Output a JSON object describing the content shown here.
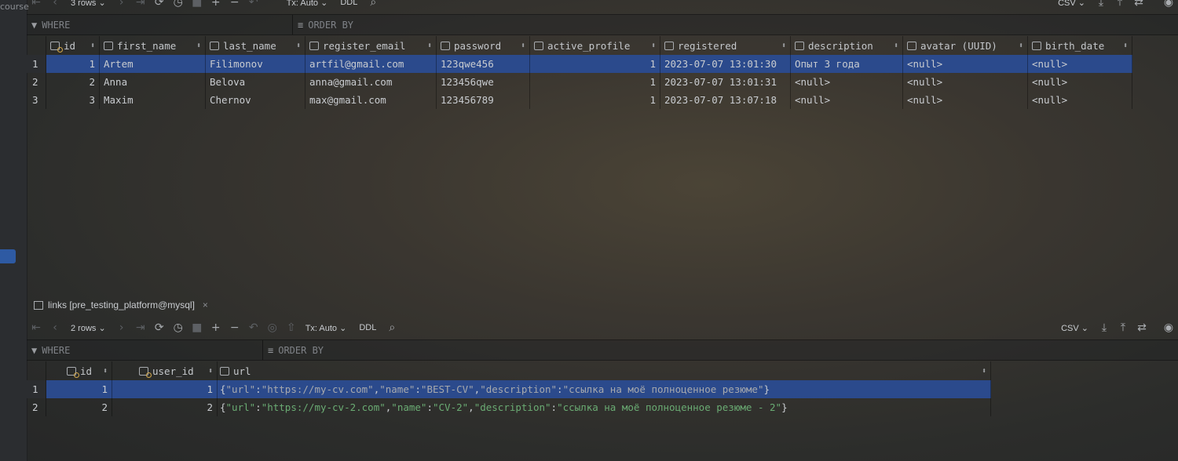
{
  "left_panel": {
    "partial_label": "course"
  },
  "top_table": {
    "toolbar": {
      "rows": "3 rows",
      "tx": "Tx: Auto",
      "ddl": "DDL",
      "export": "CSV"
    },
    "filter": {
      "where": "WHERE",
      "order_by": "ORDER BY"
    },
    "columns": [
      "id",
      "first_name",
      "last_name",
      "register_email",
      "password",
      "active_profile",
      "registered",
      "description",
      "avatar (UUID)",
      "birth_date"
    ],
    "rows": [
      {
        "n": "1",
        "cells": [
          "1",
          "Artem",
          "Filimonov",
          "artfil@gmail.com",
          "123qwe456",
          "1",
          "2023-07-07 13:01:30",
          "Опыт 3 года",
          "<null>",
          "<null>"
        ]
      },
      {
        "n": "2",
        "cells": [
          "2",
          "Anna",
          "Belova",
          "anna@gmail.com",
          "123456qwe",
          "1",
          "2023-07-07 13:01:31",
          "<null>",
          "<null>",
          "<null>"
        ]
      },
      {
        "n": "3",
        "cells": [
          "3",
          "Maxim",
          "Chernov",
          "max@gmail.com",
          "123456789",
          "1",
          "2023-07-07 13:07:18",
          "<null>",
          "<null>",
          "<null>"
        ]
      }
    ]
  },
  "bottom_table": {
    "tab_title": "links [pre_testing_platform@mysql]",
    "toolbar": {
      "rows": "2 rows",
      "tx": "Tx: Auto",
      "ddl": "DDL",
      "export": "CSV"
    },
    "filter": {
      "where": "WHERE",
      "order_by": "ORDER BY"
    },
    "columns": [
      "id",
      "user_id",
      "url"
    ],
    "rows": [
      {
        "n": "1",
        "id": "1",
        "user_id": "1",
        "url_json": {
          "url": "https://my-cv.com",
          "name": "BEST-CV",
          "description": "ссылка на моё полноценное резюме"
        }
      },
      {
        "n": "2",
        "id": "2",
        "user_id": "2",
        "url_json": {
          "url": "https://my-cv-2.com",
          "name": "CV-2",
          "description": "ссылка на моё полноценное резюме - 2"
        }
      }
    ]
  }
}
